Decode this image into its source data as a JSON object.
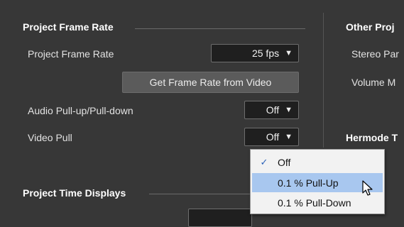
{
  "left_panel": {
    "frame_rate_section": {
      "title": "Project Frame Rate",
      "frame_rate_label": "Project Frame Rate",
      "frame_rate_value": "25 fps",
      "get_from_video_button": "Get Frame Rate from Video",
      "pull_label": "Audio Pull-up/Pull-down",
      "pull_value": "Off",
      "video_pull_label": "Video Pull",
      "video_pull_value": "Off"
    },
    "time_displays_section": {
      "title": "Project Time Displays"
    }
  },
  "right_panel": {
    "other_section_title": "Other Proj",
    "stereo_label": "Stereo Par",
    "volume_label": "Volume M",
    "hermode_title": "Hermode T"
  },
  "video_pull_menu": {
    "items": [
      {
        "label": "Off",
        "checked": true,
        "highlighted": false
      },
      {
        "label": "0.1 % Pull-Up",
        "checked": false,
        "highlighted": true
      },
      {
        "label": "0.1 % Pull-Down",
        "checked": false,
        "highlighted": false
      }
    ]
  },
  "icons": {
    "dropdown_arrow": "chevron-down-icon",
    "checkmark": "checkmark-icon",
    "cursor": "mouse-pointer-icon"
  },
  "colors": {
    "background": "#373737",
    "menu_background": "#f2f2f2",
    "menu_highlight": "#a8c7ef",
    "check_color": "#2b62b8"
  }
}
